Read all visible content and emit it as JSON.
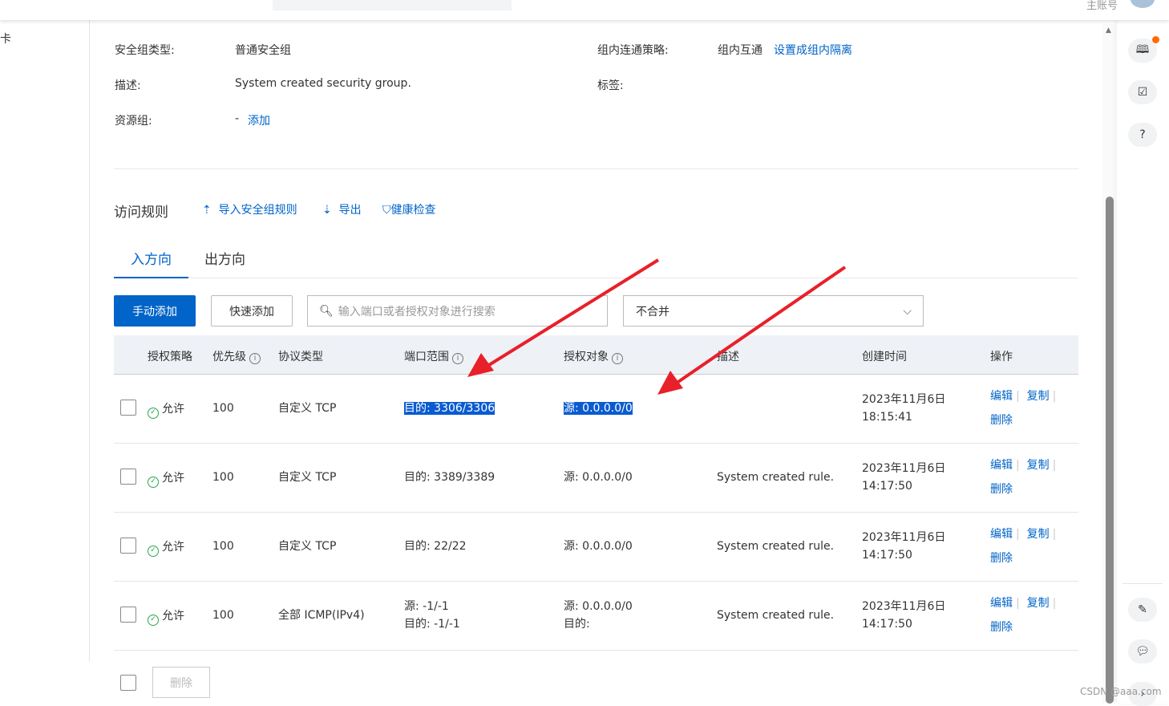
{
  "header": {
    "account": "主账号"
  },
  "sidebar": {
    "fragment": "卡"
  },
  "details": {
    "type_label": "安全组类型:",
    "type_value": "普通安全组",
    "policy_label": "组内连通策略:",
    "policy_value": "组内互通",
    "policy_link": "设置成组内隔离",
    "desc_label": "描述:",
    "desc_value": "System created security group.",
    "tags_label": "标签:",
    "rg_label": "资源组:",
    "rg_value": "-",
    "rg_link": "添加"
  },
  "rules": {
    "title": "访问规则",
    "import": "导入安全组规则",
    "export": "导出",
    "health": "健康检查",
    "tabs": [
      {
        "label": "入方向"
      },
      {
        "label": "出方向"
      }
    ],
    "manual_add": "手动添加",
    "quick_add": "快速添加",
    "search_placeholder": "输入端口或者授权对象进行搜索",
    "merge_select": "不合并",
    "columns": [
      "授权策略",
      "优先级",
      "协议类型",
      "端口范围",
      "授权对象",
      "描述",
      "创建时间",
      "操作"
    ],
    "rows": [
      {
        "policy": "允许",
        "priority": "100",
        "protocol": "自定义 TCP",
        "port": "目的: 3306/3306",
        "port2": "",
        "object": "源: 0.0.0.0/0",
        "object2": "",
        "desc": "",
        "date": "2023年11月6日",
        "time": "18:15:41"
      },
      {
        "policy": "允许",
        "priority": "100",
        "protocol": "自定义 TCP",
        "port": "目的: 3389/3389",
        "port2": "",
        "object": "源: 0.0.0.0/0",
        "object2": "",
        "desc": "System created rule.",
        "date": "2023年11月6日",
        "time": "14:17:50"
      },
      {
        "policy": "允许",
        "priority": "100",
        "protocol": "自定义 TCP",
        "port": "目的: 22/22",
        "port2": "",
        "object": "源: 0.0.0.0/0",
        "object2": "",
        "desc": "System created rule.",
        "date": "2023年11月6日",
        "time": "14:17:50"
      },
      {
        "policy": "允许",
        "priority": "100",
        "protocol": "全部 ICMP(IPv4)",
        "port": "源: -1/-1",
        "port2": "目的: -1/-1",
        "object": "源: 0.0.0.0/0",
        "object2": "目的:",
        "desc": "System created rule.",
        "date": "2023年11月6日",
        "time": "14:17:50"
      }
    ],
    "actions": {
      "edit": "编辑",
      "copy": "复制",
      "delete": "删除"
    },
    "bulk_delete": "删除"
  },
  "watermark": "CSDN @aaa.com",
  "colors": {
    "primary": "#0064c8",
    "arrow": "#e8202a"
  }
}
